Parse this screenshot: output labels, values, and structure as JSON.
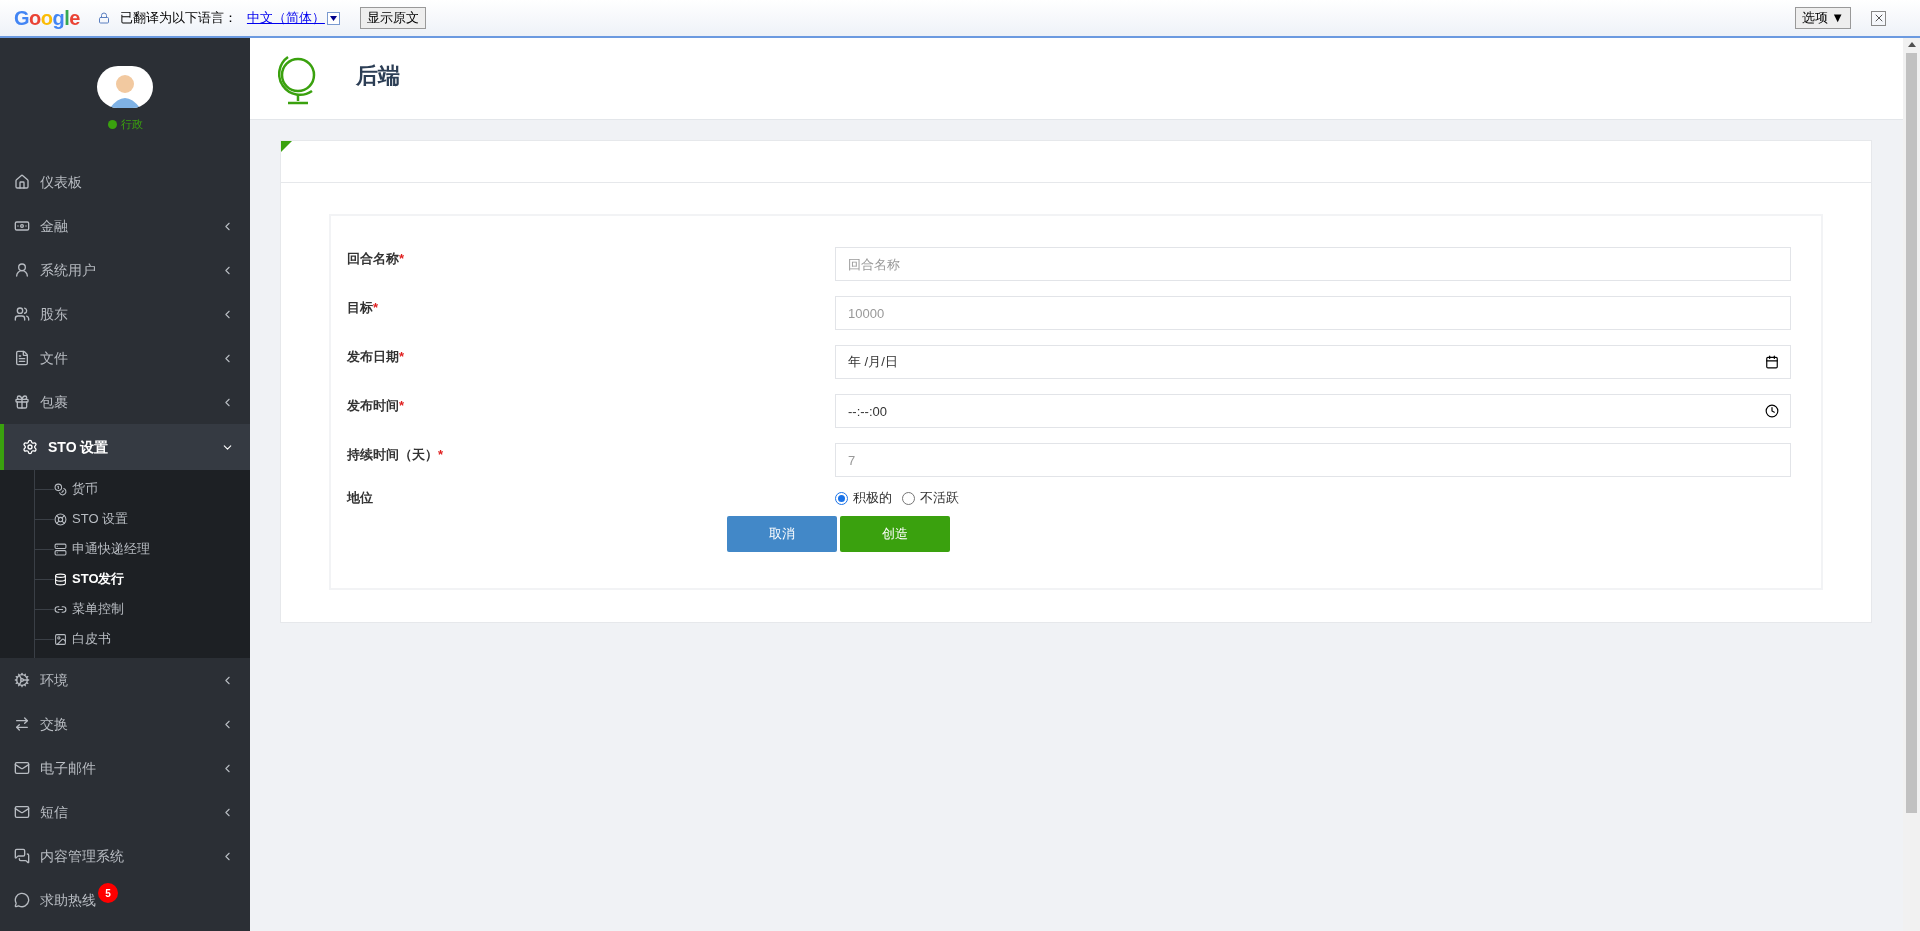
{
  "translate_bar": {
    "logo": "Google",
    "message": "已翻译为以下语言：",
    "language": "中文（简体）",
    "show_original": "显示原文",
    "options": "选项 ▼"
  },
  "sidebar": {
    "user": {
      "status": "行政"
    },
    "items": [
      {
        "label": "仪表板",
        "has_caret": false,
        "expanded": false
      },
      {
        "label": "金融",
        "has_caret": true,
        "expanded": false
      },
      {
        "label": "系统用户",
        "has_caret": true,
        "expanded": false
      },
      {
        "label": "股东",
        "has_caret": true,
        "expanded": false
      },
      {
        "label": "文件",
        "has_caret": true,
        "expanded": false
      },
      {
        "label": "包裹",
        "has_caret": true,
        "expanded": false
      },
      {
        "label": "STO 设置",
        "has_caret": true,
        "expanded": true,
        "children": [
          {
            "label": "货币",
            "selected": false
          },
          {
            "label": "STO 设置",
            "selected": false
          },
          {
            "label": "申通快递经理",
            "selected": false
          },
          {
            "label": "STO发行",
            "selected": true
          },
          {
            "label": "菜单控制",
            "selected": false
          },
          {
            "label": "白皮书",
            "selected": false
          }
        ]
      },
      {
        "label": "环境",
        "has_caret": true,
        "expanded": false
      },
      {
        "label": "交换",
        "has_caret": true,
        "expanded": false
      },
      {
        "label": "电子邮件",
        "has_caret": true,
        "expanded": false
      },
      {
        "label": "短信",
        "has_caret": true,
        "expanded": false
      },
      {
        "label": "内容管理系统",
        "has_caret": true,
        "expanded": false
      },
      {
        "label": "求助热线",
        "has_caret": false,
        "expanded": false,
        "badge": "5"
      }
    ]
  },
  "header": {
    "title": "后端"
  },
  "form": {
    "fields": [
      {
        "label": "回合名称",
        "required_mark": "*",
        "kind": "text",
        "placeholder": "回合名称"
      },
      {
        "label": "目标",
        "required_mark": "*",
        "kind": "number",
        "placeholder": "10000"
      },
      {
        "label": "发布日期",
        "required_mark": "*",
        "kind": "date",
        "value": "年 /月/日"
      },
      {
        "label": "发布时间",
        "required_mark": "*",
        "kind": "time",
        "value": "--:--:00"
      },
      {
        "label": "持续时间（天）",
        "required_mark": "*",
        "kind": "number",
        "placeholder": "7"
      }
    ],
    "status": {
      "label": "地位",
      "options": [
        {
          "label": "积极的",
          "selected": true
        },
        {
          "label": "不活跃",
          "selected": false
        }
      ]
    },
    "buttons": [
      {
        "label": "取消",
        "kind": "cancel"
      },
      {
        "label": "创造",
        "kind": "submit"
      }
    ]
  }
}
